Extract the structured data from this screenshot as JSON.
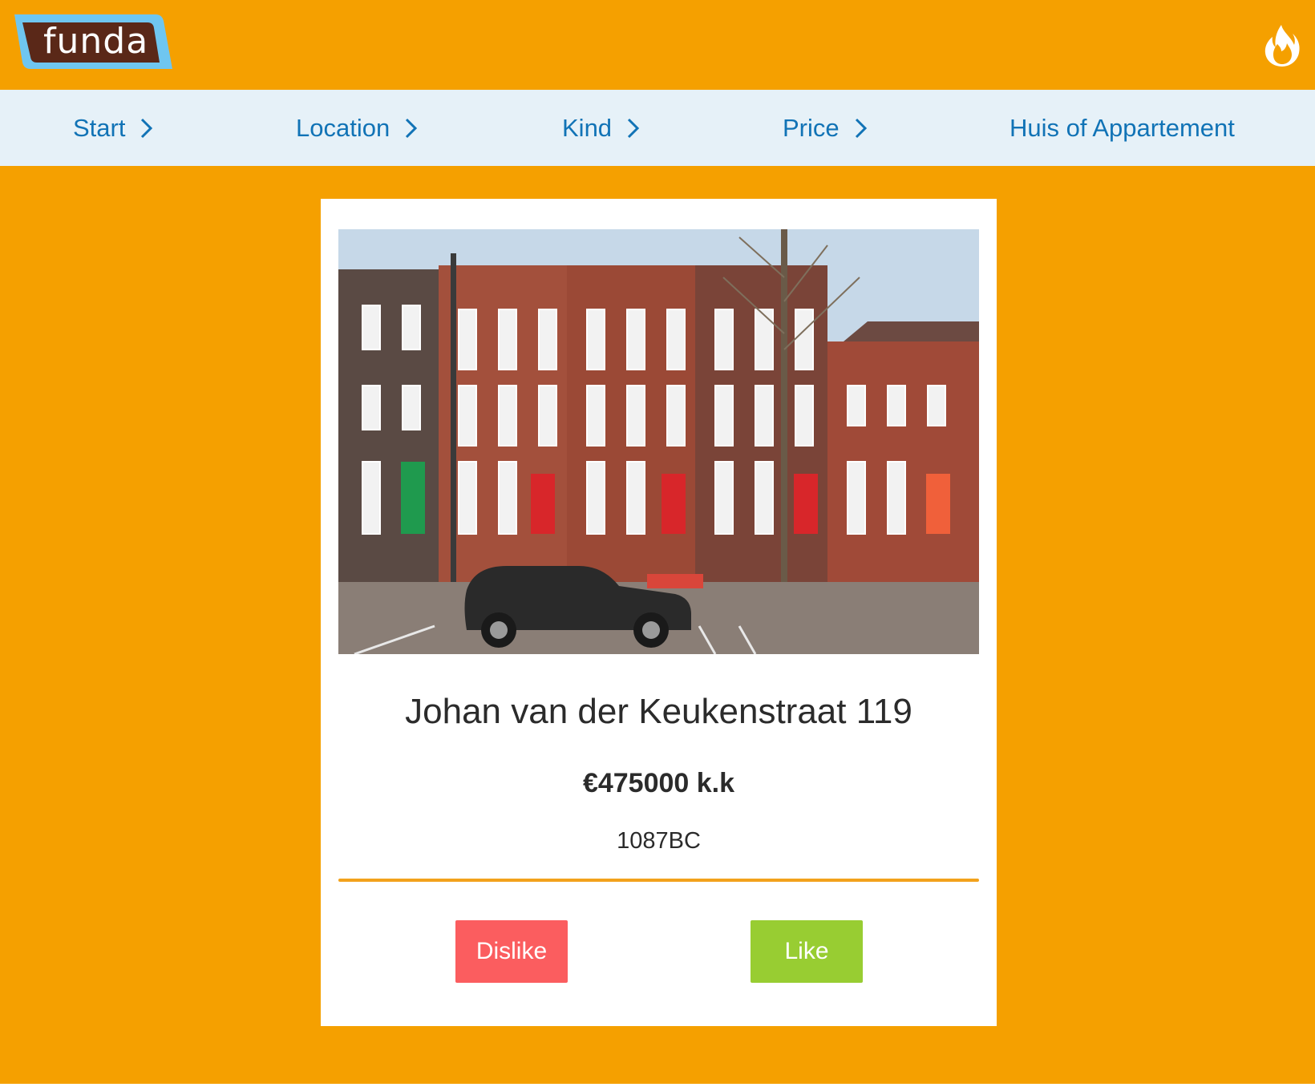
{
  "header": {
    "logo_text": "funda",
    "flame_icon": "flame-icon"
  },
  "steps": [
    {
      "label": "Start",
      "chevron": true
    },
    {
      "label": "Location",
      "chevron": true
    },
    {
      "label": "Kind",
      "chevron": true
    },
    {
      "label": "Price",
      "chevron": true
    },
    {
      "label": "Huis of Appartement",
      "chevron": false
    }
  ],
  "listing": {
    "address": "Johan van der Keukenstraat 119",
    "price": "€475000 k.k",
    "zipcode": "1087BC"
  },
  "actions": {
    "dislike_label": "Dislike",
    "like_label": "Like"
  },
  "colors": {
    "background": "#f5a000",
    "nav_background": "#e6f1f8",
    "nav_text": "#1173b6",
    "dislike": "#fb5d5f",
    "like": "#98cd32",
    "divider": "#f2a21c"
  }
}
